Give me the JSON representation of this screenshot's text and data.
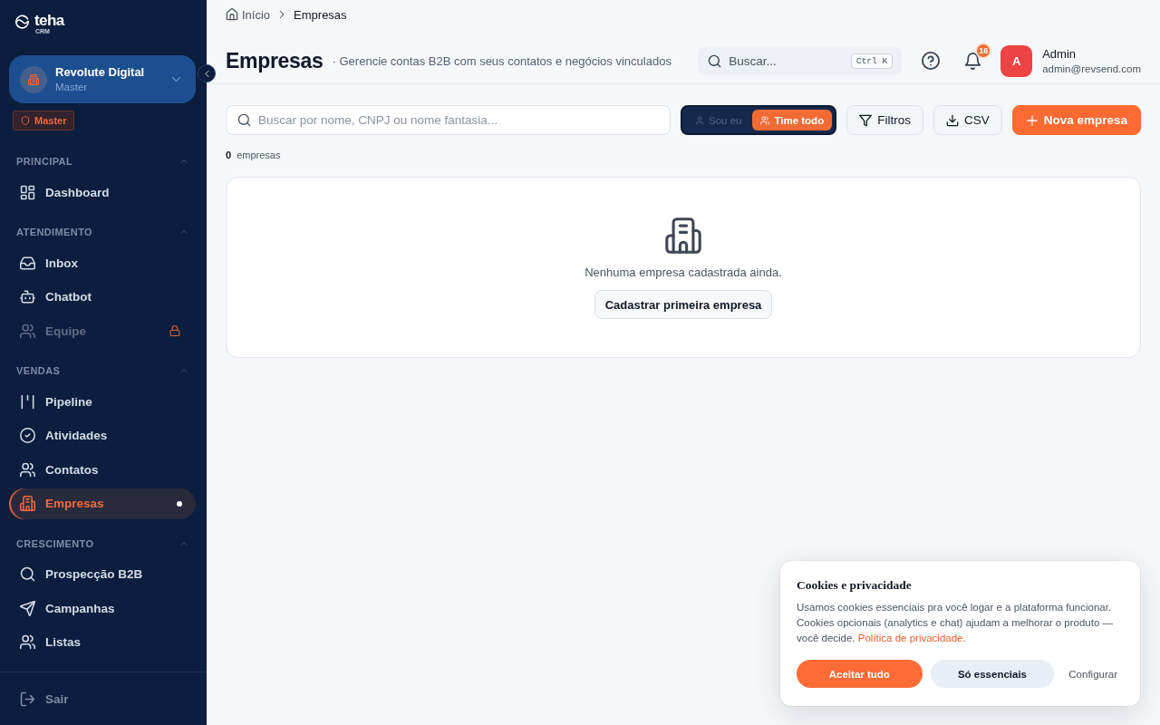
{
  "sidebar": {
    "logo": {
      "text": "teha",
      "tagline": "CRM"
    },
    "workspace": {
      "name": "Revolute Digital",
      "role": "Master"
    },
    "role_badge": "Master",
    "sections": [
      {
        "title": "PRINCIPAL",
        "expanded": true,
        "items": [
          {
            "label": "Dashboard",
            "selected": false,
            "locked": false
          }
        ]
      },
      {
        "title": "ATENDIMENTO",
        "expanded": true,
        "items": [
          {
            "label": "Inbox",
            "selected": false,
            "locked": false
          },
          {
            "label": "Chatbot",
            "selected": false,
            "locked": false
          },
          {
            "label": "Equipe",
            "selected": false,
            "locked": true
          }
        ]
      },
      {
        "title": "VENDAS",
        "expanded": true,
        "items": [
          {
            "label": "Pipeline",
            "selected": false,
            "locked": false
          },
          {
            "label": "Atividades",
            "selected": false,
            "locked": false
          },
          {
            "label": "Contatos",
            "selected": false,
            "locked": false
          },
          {
            "label": "Empresas",
            "selected": true,
            "locked": false
          }
        ]
      },
      {
        "title": "CRESCIMENTO",
        "expanded": true,
        "items": [
          {
            "label": "Prospecção B2B",
            "selected": false,
            "locked": false
          },
          {
            "label": "Campanhas",
            "selected": false,
            "locked": false
          },
          {
            "label": "Listas",
            "selected": false,
            "locked": false
          }
        ]
      }
    ],
    "logout": "Sair"
  },
  "breadcrumb": [
    {
      "label": "Início"
    },
    {
      "label": "Empresas"
    }
  ],
  "header": {
    "title": "Empresas",
    "subtitle": "· Gerencie contas B2B com seus contatos e negócios vinculados",
    "search": {
      "placeholder": "Buscar...",
      "shortcut": "Ctrl K"
    },
    "notifications": {
      "count": "16"
    },
    "user": {
      "initial": "A",
      "name": "Admin",
      "email": "admin@revsend.com"
    }
  },
  "toolbar": {
    "search": {
      "placeholder": "Buscar por nome, CNPJ ou nome fantasia..."
    },
    "scope": [
      {
        "label": "Sou eu",
        "selected": false
      },
      {
        "label": "Time todo",
        "selected": true
      }
    ],
    "buttons": [
      {
        "label": "Filtros",
        "kind": "outline"
      },
      {
        "label": "CSV",
        "kind": "outline"
      },
      {
        "label": "Nova empresa",
        "kind": "primary"
      }
    ]
  },
  "result_count": {
    "count": "0",
    "label": "empresas"
  },
  "empty_state": {
    "message": "Nenhuma empresa cadastrada ainda.",
    "action": "Cadastrar primeira empresa"
  },
  "cookie_banner": {
    "title": "Cookies e privacidade",
    "text": "Usamos cookies essenciais pra você logar e a plataforma funcionar. Cookies opcionais (analytics e chat) ajudam a melhorar o produto — você decide.",
    "link": "Política de privacidade",
    "text_after": ".",
    "buttons": [
      {
        "label": "Aceitar tudo",
        "kind": "primary"
      },
      {
        "label": "Só essenciais",
        "kind": "secondary"
      },
      {
        "label": "Configurar",
        "kind": "link"
      }
    ]
  }
}
